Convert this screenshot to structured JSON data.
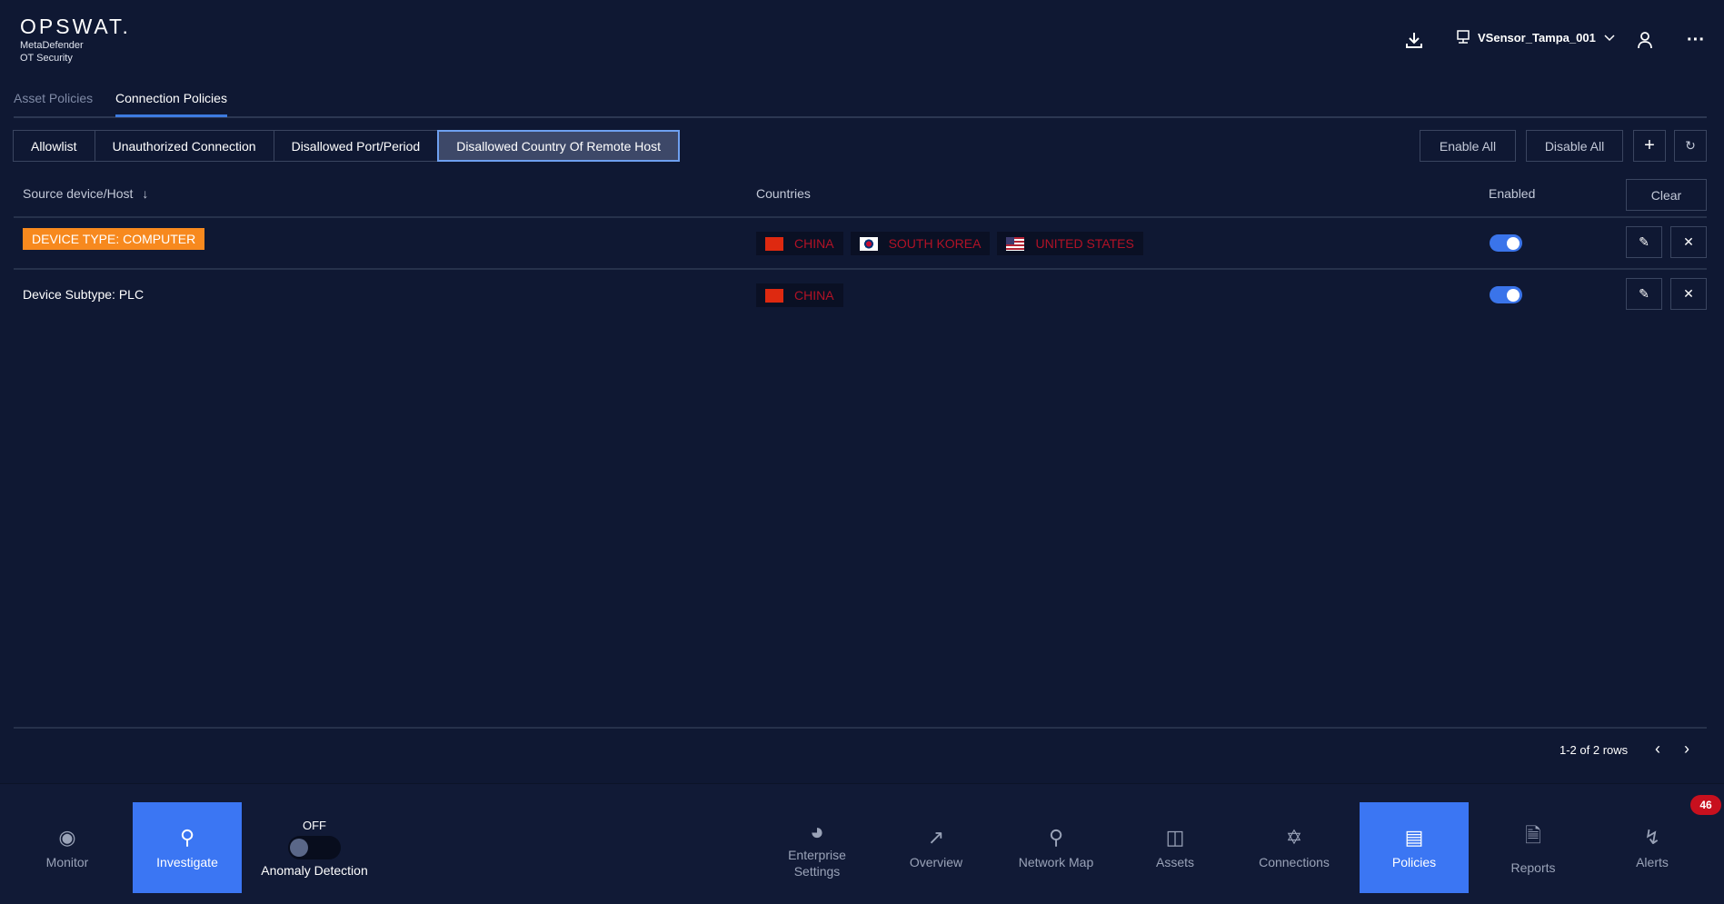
{
  "logo": {
    "brand": "OPSWAT.",
    "line1": "MetaDefender",
    "line2": "OT Security"
  },
  "header": {
    "sensor": "VSensor_Tampa_001"
  },
  "tabs": [
    {
      "label": "Asset Policies"
    },
    {
      "label": "Connection Policies"
    }
  ],
  "filters": [
    {
      "label": "Allowlist"
    },
    {
      "label": "Unauthorized Connection"
    },
    {
      "label": "Disallowed Port/Period"
    },
    {
      "label": "Disallowed Country Of Remote Host"
    }
  ],
  "actions": {
    "enable_all": "Enable All",
    "disable_all": "Disable All",
    "clear": "Clear"
  },
  "table": {
    "columns": {
      "source": "Source device/Host",
      "countries": "Countries",
      "enabled": "Enabled"
    },
    "rows": [
      {
        "source": "DEVICE TYPE: COMPUTER",
        "countries": [
          "CHINA",
          "SOUTH KOREA",
          "UNITED STATES"
        ],
        "enabled": true
      },
      {
        "source": "Device Subtype: PLC",
        "countries": [
          "CHINA"
        ],
        "enabled": true
      }
    ]
  },
  "pager": {
    "text": "1-2 of 2 rows"
  },
  "nav": {
    "monitor": "Monitor",
    "investigate": "Investigate",
    "anomaly_state": "OFF",
    "anomaly": "Anomaly Detection",
    "enterprise1": "Enterprise",
    "enterprise2": "Settings",
    "overview": "Overview",
    "network_map": "Network Map",
    "assets": "Assets",
    "connections": "Connections",
    "policies": "Policies",
    "reports": "Reports",
    "alerts": "Alerts",
    "alerts_badge": "46"
  }
}
